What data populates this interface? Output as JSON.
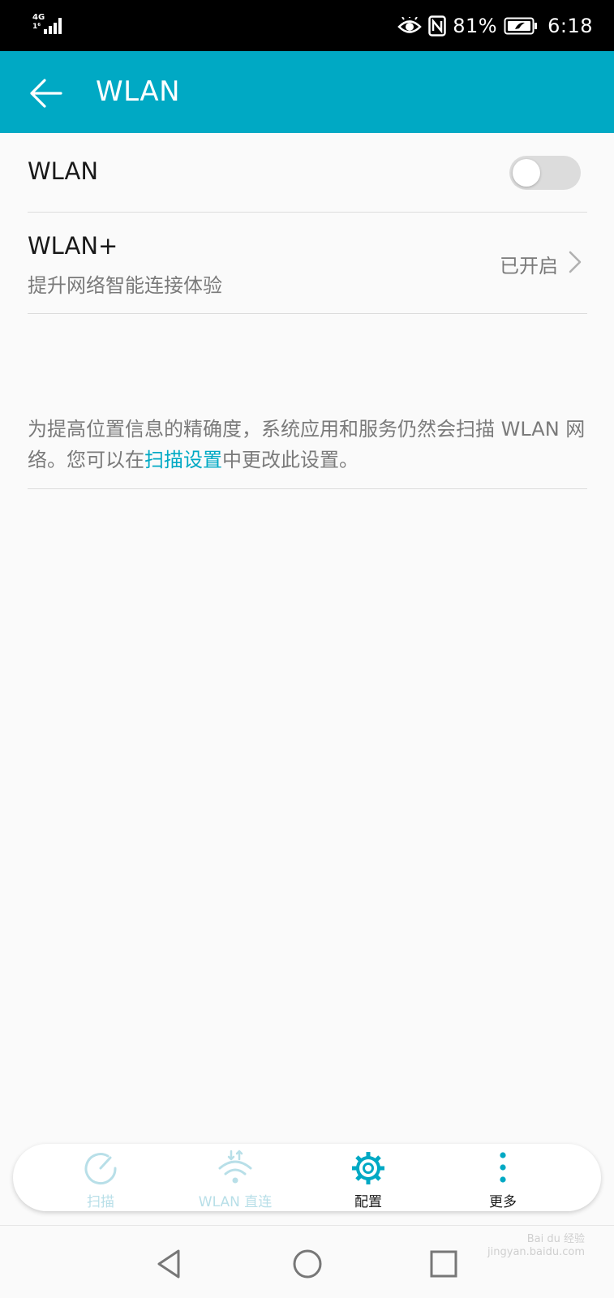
{
  "status_bar": {
    "network": "4G",
    "network_sub": "1⁶",
    "battery_percent": "81%",
    "time": "6:18",
    "icons": [
      "eye-comfort-icon",
      "nfc-icon",
      "battery-icon"
    ]
  },
  "app_bar": {
    "title": "WLAN",
    "back_icon": "arrow-left-icon"
  },
  "wlan_row": {
    "label": "WLAN",
    "toggle_on": false
  },
  "wlan_plus_row": {
    "label": "WLAN+",
    "subtitle": "提升网络智能连接体验",
    "status": "已开启"
  },
  "info": {
    "text_before": "为提高位置信息的精确度，系统应用和服务仍然会扫描 WLAN 网络。您可以在",
    "link": "扫描设置",
    "text_after": "中更改此设置。"
  },
  "tabs": [
    {
      "label": "扫描",
      "icon": "scan-icon",
      "active": false
    },
    {
      "label": "WLAN 直连",
      "icon": "wifi-direct-icon",
      "active": false
    },
    {
      "label": "配置",
      "icon": "gear-icon",
      "active": true
    },
    {
      "label": "更多",
      "icon": "more-vertical-icon",
      "active": true
    }
  ],
  "nav_bar": {
    "buttons": [
      "back-triangle-icon",
      "home-circle-icon",
      "recents-square-icon"
    ]
  },
  "watermark": {
    "line1": "Bai du 经验",
    "line2": "jingyan.baidu.com"
  },
  "colors": {
    "accent": "#00a9c4",
    "status_bar": "#000000",
    "background": "#fafafa"
  }
}
